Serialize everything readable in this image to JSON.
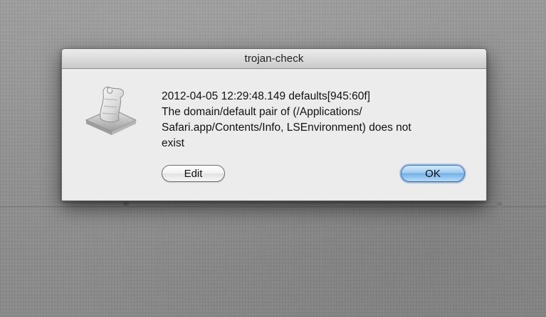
{
  "dialog": {
    "title": "trojan-check",
    "icon": "script-editor-scroll-icon",
    "message_lines": [
      "2012-04-05 12:29:48.149 defaults[945:60f]",
      "The domain/default pair of (/Applications/",
      "Safari.app/Contents/Info, LSEnvironment) does not",
      "exist"
    ],
    "buttons": {
      "edit_label": "Edit",
      "ok_label": "OK"
    },
    "default_button": "OK"
  },
  "colors": {
    "dialog_background": "#ececec",
    "default_button_accent": "#74b0e6",
    "desktop_background": "#8f8f8f"
  }
}
